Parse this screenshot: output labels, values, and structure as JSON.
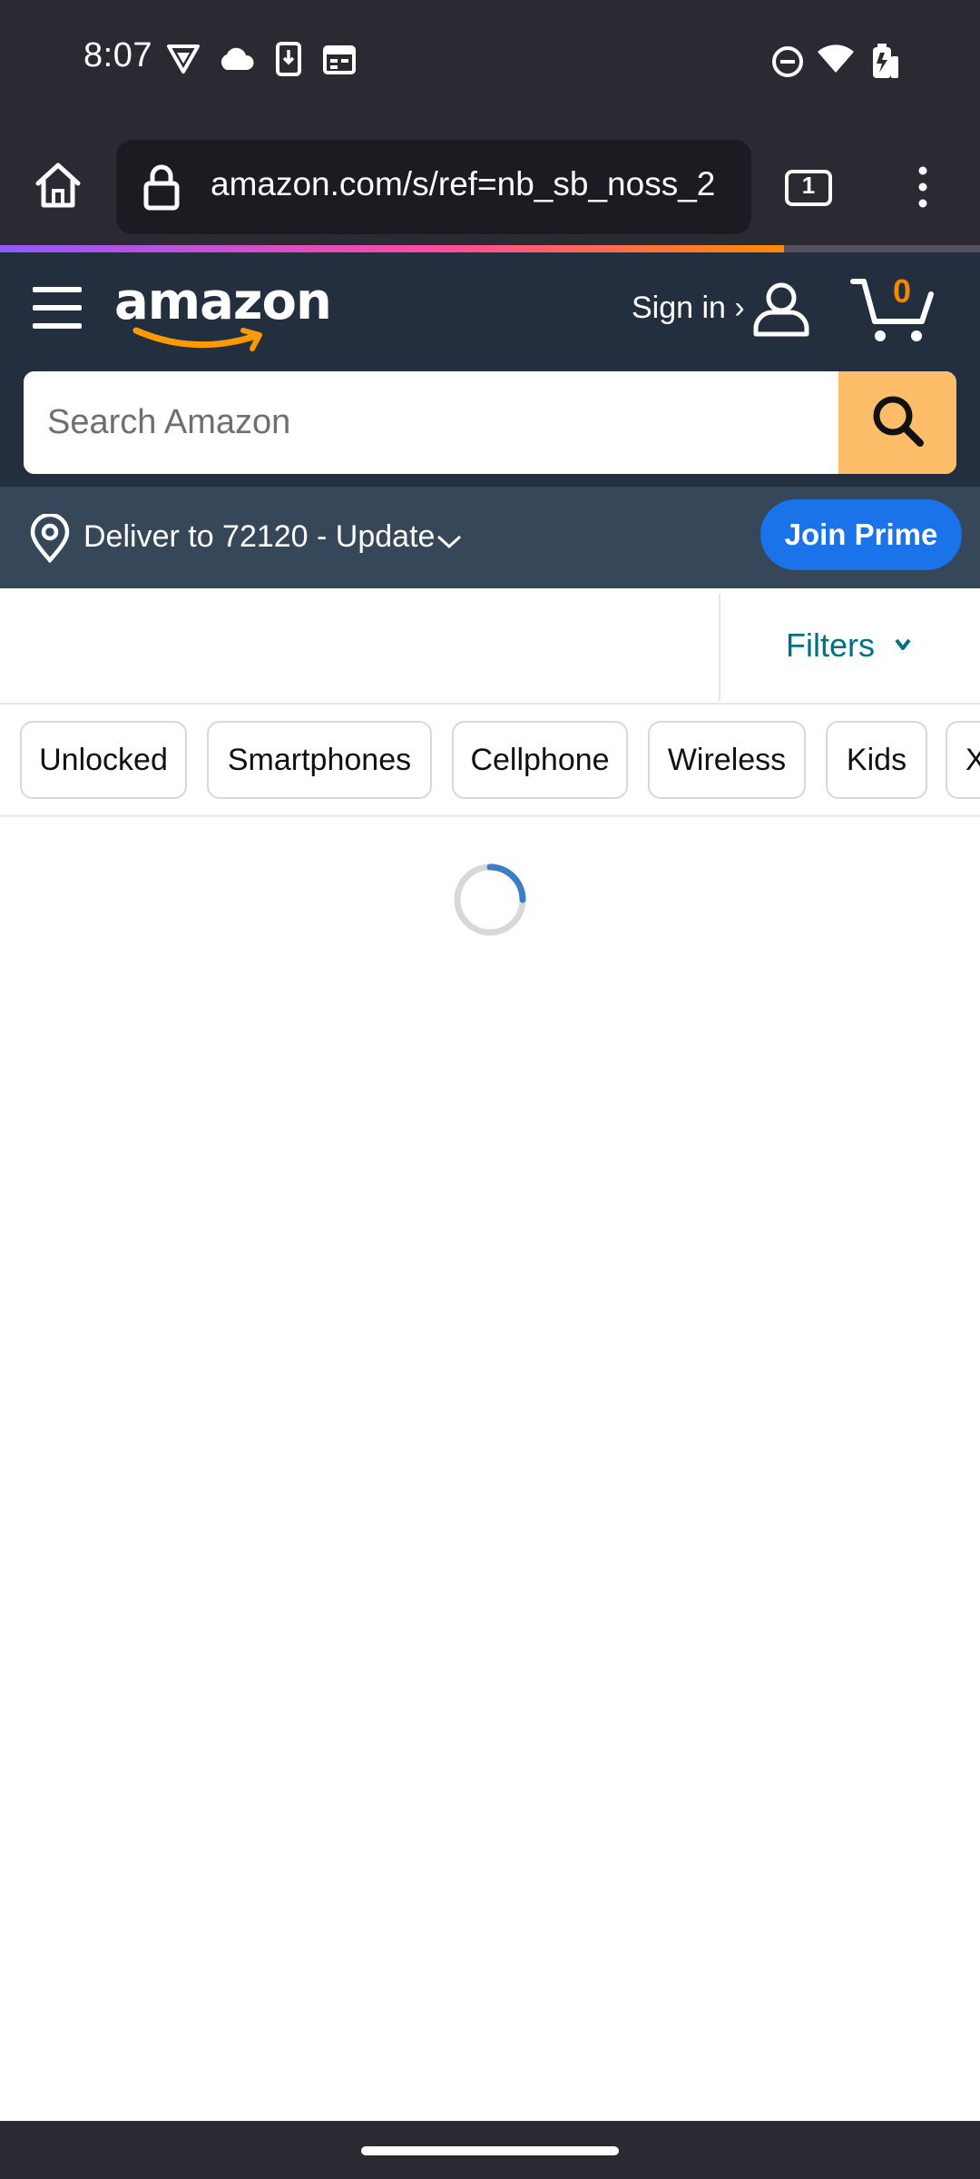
{
  "status_bar": {
    "time": "8:07",
    "left_icons": [
      "vpn-shield-icon",
      "cloud-icon",
      "phone-download-icon",
      "calendar-icon"
    ],
    "right_icons": [
      "do-not-disturb-icon",
      "wifi-icon",
      "battery-icon"
    ]
  },
  "browser": {
    "url": "amazon.com/s/ref=nb_sb_noss_2",
    "tab_count": "1",
    "load_progress": 0.8,
    "colors": {
      "toolbar": "#2b2a33",
      "url_field": "#1c1b22"
    }
  },
  "header": {
    "logo_text": "amazon",
    "signin_label": "Sign in ›",
    "cart_count": "0",
    "colors": {
      "nav": "#232f3e",
      "cart_count": "#f08804"
    }
  },
  "search": {
    "placeholder": "Search Amazon",
    "value": "",
    "colors": {
      "button": "#febd69"
    }
  },
  "delivery": {
    "text": "Deliver to 72120 - Update",
    "join_prime_label": "Join Prime",
    "colors": {
      "bar": "#37475a",
      "join_prime": "#1a73e8"
    }
  },
  "filters": {
    "label": "Filters",
    "color": "#007185"
  },
  "chips": [
    "Unlocked",
    "Smartphones",
    "Cellphone",
    "Wireless",
    "Kids",
    "X"
  ],
  "loader": {
    "state": "loading",
    "color": "#3b7ec4"
  }
}
